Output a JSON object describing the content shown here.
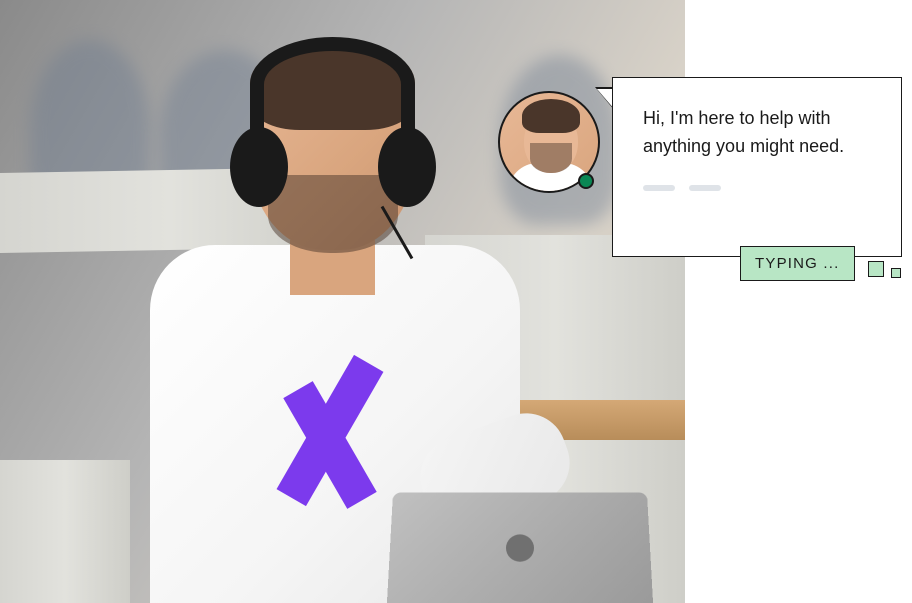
{
  "chat": {
    "message": "Hi, I'm here to help with anything you might need.",
    "status_badge": "TYPING ...",
    "status_color": "#b8e6c5",
    "presence": "online"
  },
  "brand": {
    "logo_letter": "X",
    "logo_color": "#7c3aed"
  }
}
